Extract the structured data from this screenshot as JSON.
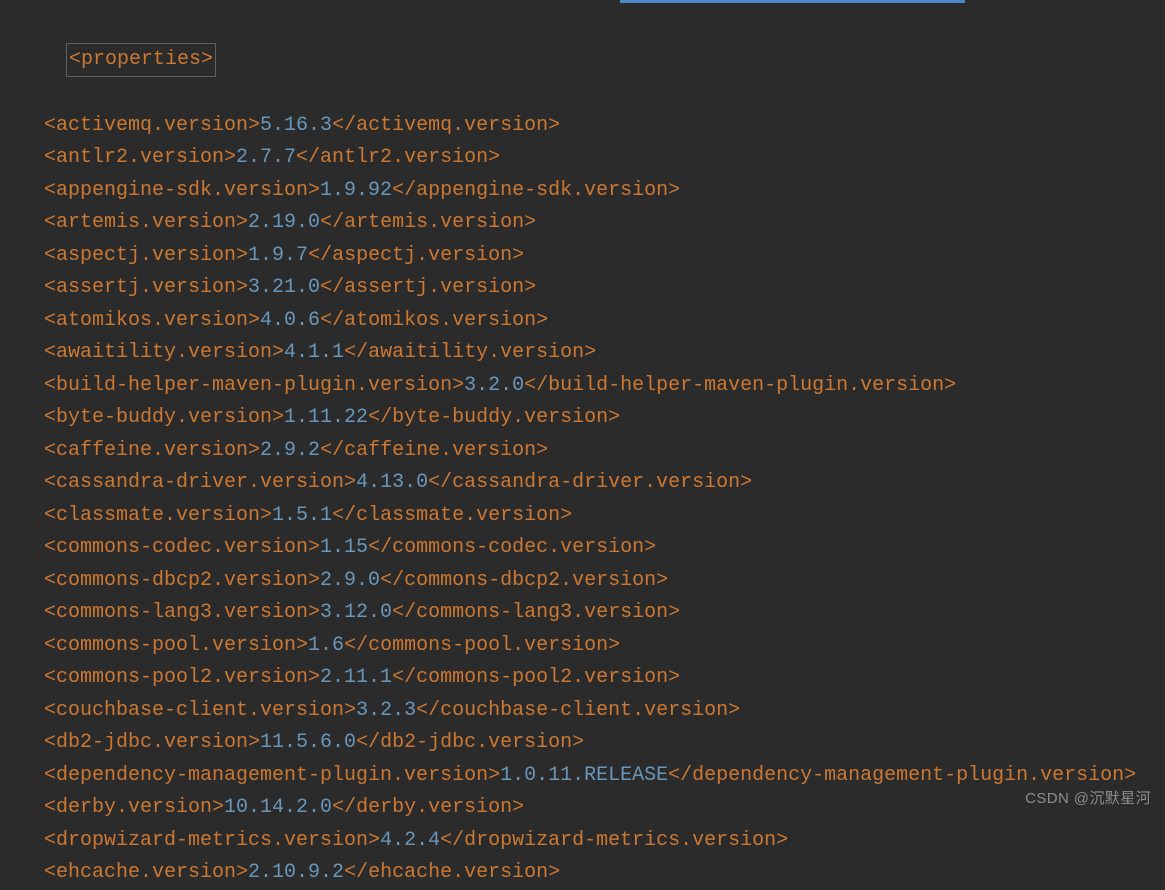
{
  "parentTag": "<properties>",
  "entries": [
    {
      "name": "activemq.version",
      "value": "5.16.3"
    },
    {
      "name": "antlr2.version",
      "value": "2.7.7"
    },
    {
      "name": "appengine-sdk.version",
      "value": "1.9.92"
    },
    {
      "name": "artemis.version",
      "value": "2.19.0"
    },
    {
      "name": "aspectj.version",
      "value": "1.9.7"
    },
    {
      "name": "assertj.version",
      "value": "3.21.0"
    },
    {
      "name": "atomikos.version",
      "value": "4.0.6"
    },
    {
      "name": "awaitility.version",
      "value": "4.1.1"
    },
    {
      "name": "build-helper-maven-plugin.version",
      "value": "3.2.0"
    },
    {
      "name": "byte-buddy.version",
      "value": "1.11.22"
    },
    {
      "name": "caffeine.version",
      "value": "2.9.2"
    },
    {
      "name": "cassandra-driver.version",
      "value": "4.13.0"
    },
    {
      "name": "classmate.version",
      "value": "1.5.1"
    },
    {
      "name": "commons-codec.version",
      "value": "1.15"
    },
    {
      "name": "commons-dbcp2.version",
      "value": "2.9.0"
    },
    {
      "name": "commons-lang3.version",
      "value": "3.12.0"
    },
    {
      "name": "commons-pool.version",
      "value": "1.6"
    },
    {
      "name": "commons-pool2.version",
      "value": "2.11.1"
    },
    {
      "name": "couchbase-client.version",
      "value": "3.2.3"
    },
    {
      "name": "db2-jdbc.version",
      "value": "11.5.6.0"
    },
    {
      "name": "dependency-management-plugin.version",
      "value": "1.0.11.RELEASE"
    },
    {
      "name": "derby.version",
      "value": "10.14.2.0"
    },
    {
      "name": "dropwizard-metrics.version",
      "value": "4.2.4"
    },
    {
      "name": "ehcache.version",
      "value": "2.10.9.2"
    }
  ],
  "watermark": "CSDN @沉默星河"
}
